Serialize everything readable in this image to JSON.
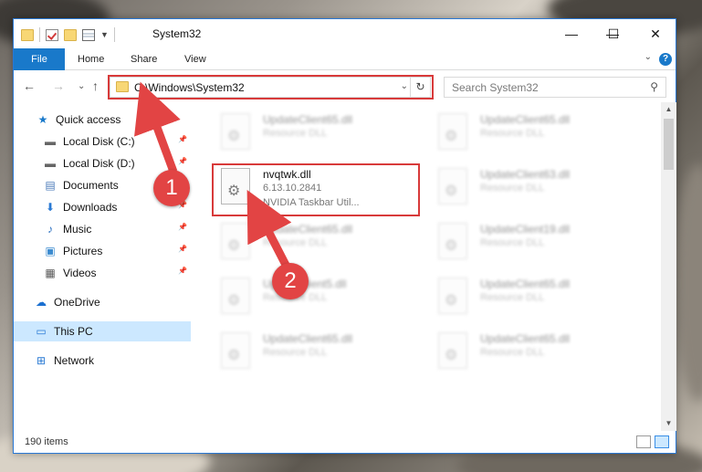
{
  "window": {
    "title": "System32",
    "controls": {
      "minimize": "—",
      "maximize": "☐",
      "close": "✕"
    }
  },
  "ribbon": {
    "tabs": [
      {
        "label": "File"
      },
      {
        "label": "Home"
      },
      {
        "label": "Share"
      },
      {
        "label": "View"
      }
    ],
    "help": "?"
  },
  "navigation": {
    "back": "←",
    "forward": "→",
    "recent": "⌄",
    "up": "↑",
    "address": "C:\\Windows\\System32",
    "refresh": "↻",
    "search_placeholder": "Search System32"
  },
  "sidebar": {
    "items": [
      {
        "label": "Quick access",
        "icon": "star-icon",
        "pinned": false
      },
      {
        "label": "Local Disk (C:)",
        "icon": "drive-icon",
        "pinned": true
      },
      {
        "label": "Local Disk (D:)",
        "icon": "drive-icon",
        "pinned": true
      },
      {
        "label": "Documents",
        "icon": "documents-icon",
        "pinned": true
      },
      {
        "label": "Downloads",
        "icon": "download-icon",
        "pinned": true
      },
      {
        "label": "Music",
        "icon": "music-icon",
        "pinned": true
      },
      {
        "label": "Pictures",
        "icon": "pictures-icon",
        "pinned": true
      },
      {
        "label": "Videos",
        "icon": "videos-icon",
        "pinned": true
      },
      {
        "label": "OneDrive",
        "icon": "cloud-icon",
        "pinned": false
      },
      {
        "label": "This PC",
        "icon": "computer-icon",
        "pinned": false,
        "selected": true
      },
      {
        "label": "Network",
        "icon": "network-icon",
        "pinned": false
      }
    ]
  },
  "files": {
    "left_column": [
      {
        "name": "UpdateClient65.dll",
        "type": "Resource DLL",
        "blurred": true
      },
      {
        "name": "nvqtwk.dll",
        "version": "6.13.10.2841",
        "description": "NVIDIA Taskbar Util...",
        "blurred": false,
        "highlighted": true
      },
      {
        "name": "UpdateClient65.dll",
        "type": "Resource DLL",
        "blurred": true
      },
      {
        "name": "UpdateClient5.dll",
        "type": "Resource DLL",
        "blurred": true
      },
      {
        "name": "UpdateClient65.dll",
        "type": "Resource DLL",
        "blurred": true
      }
    ],
    "right_column": [
      {
        "name": "UpdateClient65.dll",
        "type": "Resource DLL",
        "blurred": true
      },
      {
        "name": "UpdateClient63.dll",
        "type": "Resource DLL",
        "blurred": true
      },
      {
        "name": "UpdateClient19.dll",
        "type": "Resource DLL",
        "blurred": true
      },
      {
        "name": "UpdateClient65.dll",
        "type": "Resource DLL",
        "blurred": true
      },
      {
        "name": "UpdateClient65.dll",
        "type": "Resource DLL",
        "blurred": true
      }
    ]
  },
  "status": {
    "item_count": "190 items"
  },
  "annotations": {
    "step1": "1",
    "step2": "2",
    "color": "#e24444"
  }
}
